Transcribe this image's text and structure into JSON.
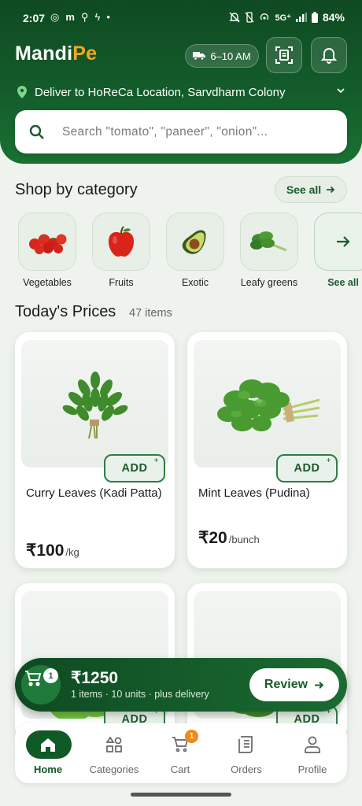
{
  "status_bar": {
    "time": "2:07",
    "network": "5G⁺",
    "battery": "84%"
  },
  "header": {
    "logo_main": "Mandi",
    "logo_accent": "Pe",
    "eta": "6–10 AM",
    "location": "Deliver to HoReCa Location, Sarvdharm Colony"
  },
  "search": {
    "placeholder": "Search \"tomato\", \"paneer\", \"onion\"..."
  },
  "categories": {
    "title": "Shop by category",
    "see_all": "See all",
    "items": [
      {
        "label": "Vegetables",
        "icon": "tomatoes-icon"
      },
      {
        "label": "Fruits",
        "icon": "apple-icon"
      },
      {
        "label": "Exotic",
        "icon": "avocado-icon"
      },
      {
        "label": "Leafy greens",
        "icon": "spinach-icon"
      }
    ],
    "more_label": "See all"
  },
  "todays_prices": {
    "title": "Today's Prices",
    "count": "47 items",
    "products": [
      {
        "name": "Curry Leaves (Kadi Patta)",
        "price": "₹100",
        "unit": "/kg",
        "add": "ADD",
        "icon": "curry-leaves-icon"
      },
      {
        "name": "Mint Leaves (Pudina)",
        "price": "₹20",
        "unit": "/bunch",
        "add": "ADD",
        "icon": "mint-leaves-icon"
      },
      {
        "name": "",
        "price": "",
        "unit": "",
        "add": "ADD",
        "icon": "lettuce-icon"
      },
      {
        "name": "",
        "price": "",
        "unit": "",
        "add": "ADD",
        "icon": "spinach-bunch-icon"
      }
    ]
  },
  "cart_bar": {
    "count": "1",
    "total": "₹1250",
    "summary": "1 items · 10 units · plus delivery",
    "review": "Review"
  },
  "bottom_nav": {
    "items": [
      {
        "label": "Home",
        "icon": "home-icon",
        "active": true
      },
      {
        "label": "Categories",
        "icon": "categories-icon"
      },
      {
        "label": "Cart",
        "icon": "cart-icon",
        "badge": "1"
      },
      {
        "label": "Orders",
        "icon": "orders-icon"
      },
      {
        "label": "Profile",
        "icon": "profile-icon"
      }
    ]
  },
  "colors": {
    "brand_green": "#0f4a22",
    "accent_orange": "#f5a623",
    "badge_orange": "#f08a1c"
  }
}
